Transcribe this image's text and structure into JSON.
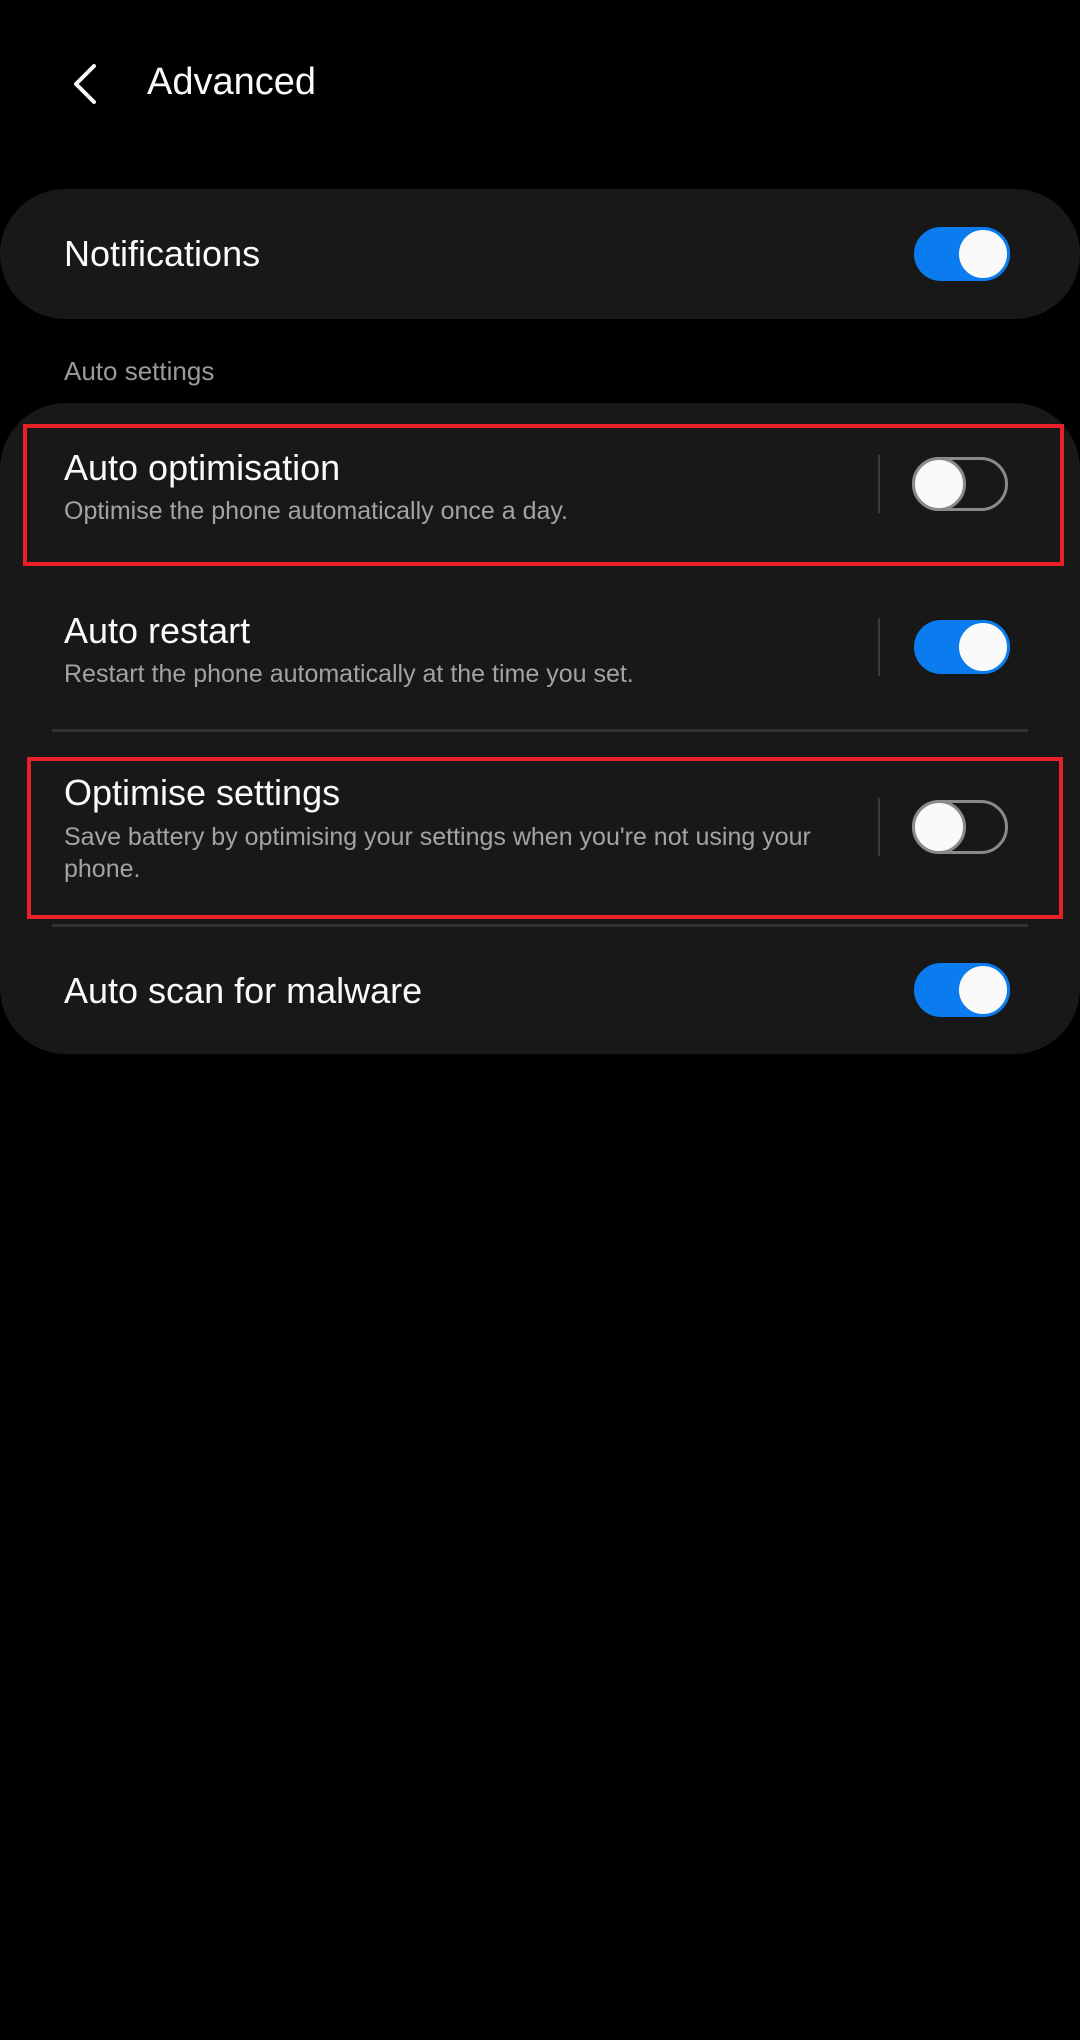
{
  "header": {
    "title": "Advanced",
    "back_icon": "chevron-left-icon"
  },
  "notifications": {
    "label": "Notifications",
    "enabled": true
  },
  "section_label": "Auto settings",
  "items": [
    {
      "title": "Auto optimisation",
      "subtitle": "Optimise the phone automatically once a day.",
      "enabled": false,
      "highlighted": true
    },
    {
      "title": "Auto restart",
      "subtitle": "Restart the phone automatically at the time you set.",
      "enabled": true,
      "highlighted": false
    },
    {
      "title": "Optimise settings",
      "subtitle": "Save battery by optimising your settings when you're not using your phone.",
      "enabled": false,
      "highlighted": true
    },
    {
      "title": "Auto scan for malware",
      "enabled": true,
      "highlighted": false
    }
  ],
  "colors": {
    "accent": "#0a7cf0",
    "highlight": "#e8202a",
    "card": "#181818"
  }
}
